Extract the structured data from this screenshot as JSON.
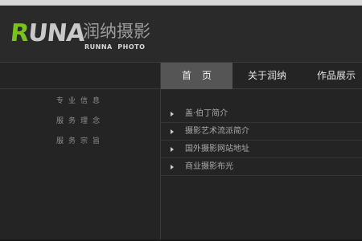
{
  "logo": {
    "runa_prefix": "R",
    "runa_rest": "UNA",
    "cn_name": "润纳摄影",
    "subtitle": "RUNNA  PHOTO"
  },
  "nav": {
    "items": [
      {
        "label": "首页",
        "active": true
      },
      {
        "label": "关于润纳",
        "active": false
      },
      {
        "label": "作品展示",
        "active": false
      }
    ]
  },
  "sidebar": {
    "items": [
      {
        "label": "专业信息"
      },
      {
        "label": "服务理念"
      },
      {
        "label": "服务宗旨"
      }
    ]
  },
  "main": {
    "list": [
      {
        "label": "盖·伯丁简介"
      },
      {
        "label": "摄影艺术流派简介"
      },
      {
        "label": "国外摄影网站地址"
      },
      {
        "label": "商业摄影布光"
      }
    ]
  },
  "colors": {
    "background": "#242424",
    "accent_green": "#79c21f",
    "nav_active": "#555555"
  }
}
